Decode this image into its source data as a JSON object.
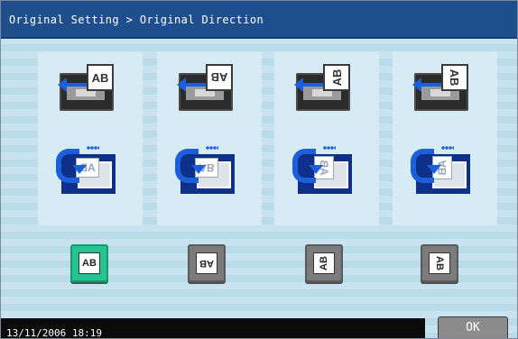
{
  "header": {
    "title": "Original Setting > Original Direction"
  },
  "options": [
    {
      "doc_label": "AB",
      "button_label": "AB",
      "selected": true,
      "orientation": "upright"
    },
    {
      "doc_label": "AB",
      "button_label": "AB",
      "selected": false,
      "orientation": "upside-down"
    },
    {
      "doc_label": "AB",
      "button_label": "AB",
      "selected": false,
      "orientation": "rotated-left"
    },
    {
      "doc_label": "AB",
      "button_label": "AB",
      "selected": false,
      "orientation": "rotated-right"
    }
  ],
  "status": {
    "datetime": "13/11/2006   18:19"
  },
  "actions": {
    "ok_label": "OK"
  },
  "colors": {
    "title_bg": "#1e4f8c",
    "selected_green": "#25c38f",
    "arrow_blue": "#1d5fd9",
    "tray_navy": "#0e2f8a"
  }
}
